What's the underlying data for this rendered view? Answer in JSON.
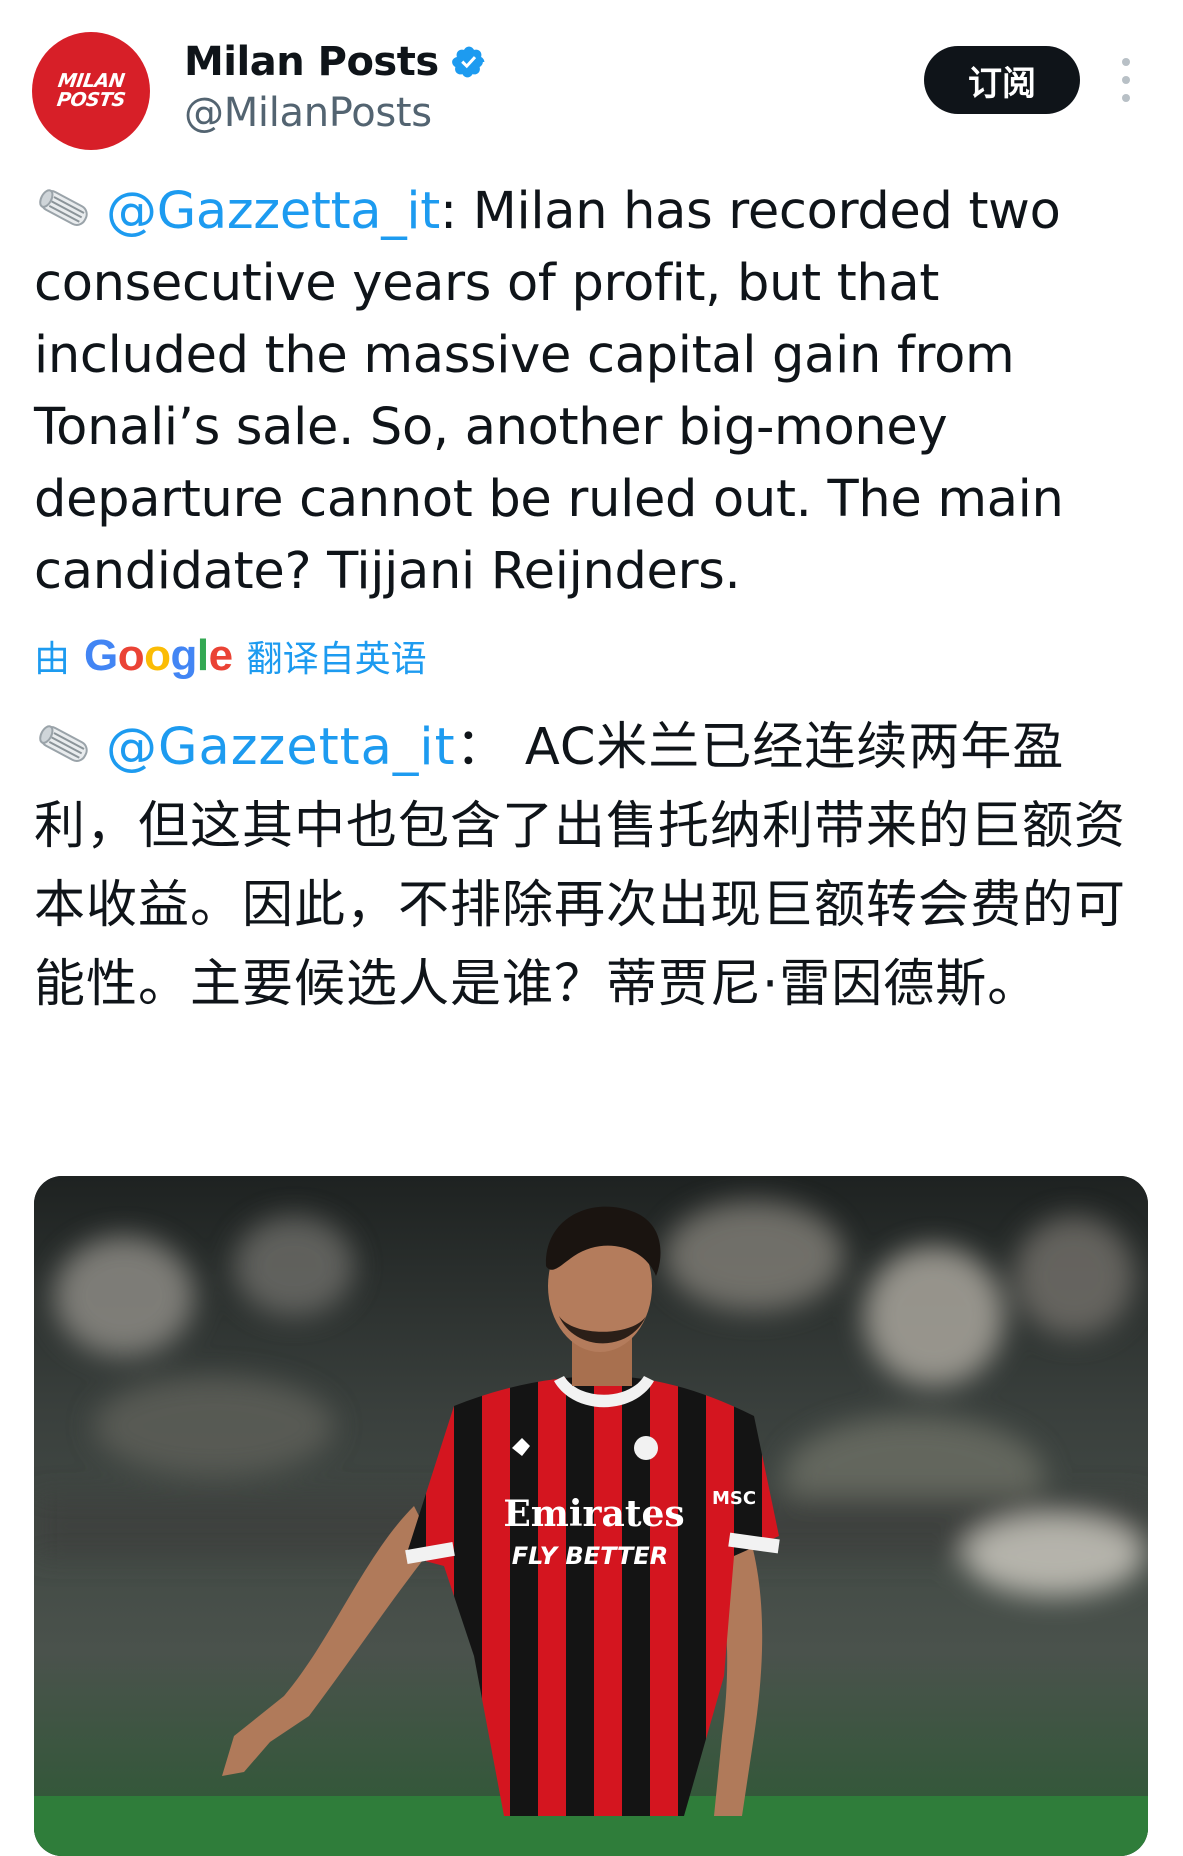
{
  "account": {
    "display_name": "Milan Posts",
    "handle": "@MilanPosts",
    "avatar_line1": "MILAN",
    "avatar_line2": "POSTS",
    "verified_icon": "verified-badge-icon",
    "verified_color": "#1d9bf0"
  },
  "actions": {
    "subscribe_label": "订阅",
    "more_icon": "more-vertical-icon"
  },
  "tweet": {
    "emoji_icon": "rolled-newspaper-icon",
    "mention": "@Gazzetta_it",
    "text": ": Milan has recorded two consecutive years of profit, but that included the massive capital gain from Tonali’s sale. So, another big-money departure cannot be ruled out. The main candidate? Tijjani Reijnders."
  },
  "translation": {
    "prefix": "由",
    "brand": "Google",
    "suffix": "翻译自英语",
    "emoji_icon": "rolled-newspaper-icon",
    "mention": "@Gazzetta_it",
    "text": "： AC米兰已经连续两年盈利，但这其中也包含了出售托纳利带来的巨额资本收益。因此，不排除再次出现巨额转会费的可能性。主要候选人是谁？蒂贾尼·雷因德斯。"
  },
  "media": {
    "shirt_line1": "Emirates",
    "shirt_line2": "FLY BETTER",
    "sleeve_text": "MSC",
    "colors": {
      "kit_red": "#d4151f",
      "kit_black": "#141414",
      "pitch_green": "#2f7d3a"
    }
  },
  "colors": {
    "link": "#1d9bf0",
    "text": "#0f1419",
    "muted": "#536471"
  }
}
